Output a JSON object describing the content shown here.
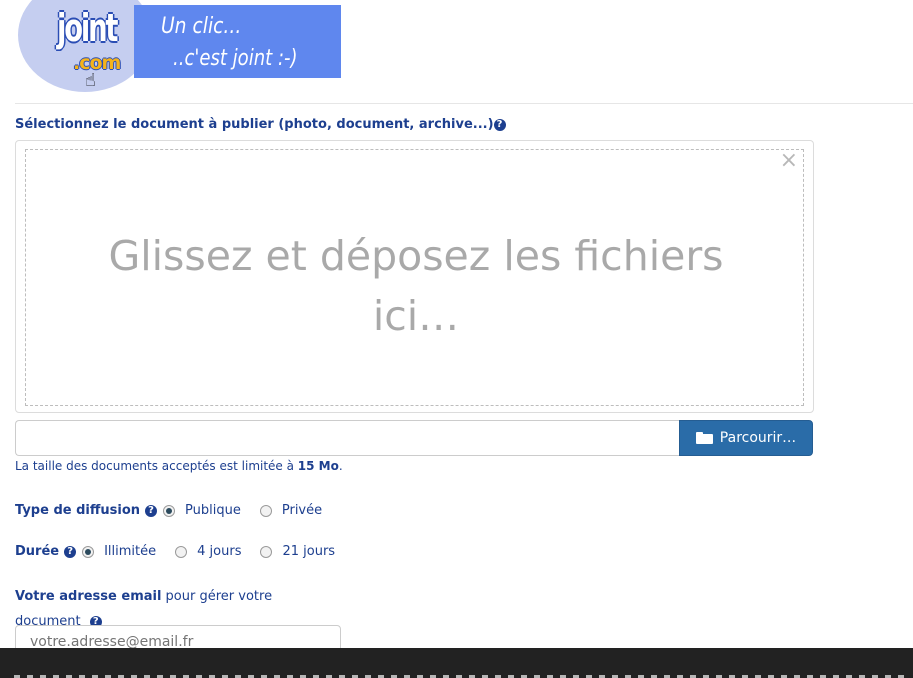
{
  "logo": {
    "joint": "joint",
    "com": ".com",
    "tagline_1": "Un clic...",
    "tagline_2": "..c'est joint :-)"
  },
  "upload": {
    "label": "Sélectionnez le document à publier (photo, document, archive...)",
    "dropzone_text": "Glissez et déposez les fichiers ici…",
    "close_symbol": "×",
    "browse_label": "Parcourir…",
    "size_note_prefix": "La taille des documents acceptés est limitée à ",
    "size_limit": "15 Mo",
    "size_note_suffix": "."
  },
  "diffusion": {
    "label": "Type de diffusion",
    "options": [
      {
        "label": "Publique",
        "checked": true
      },
      {
        "label": "Privée",
        "checked": false
      }
    ]
  },
  "duree": {
    "label": "Durée",
    "options": [
      {
        "label": "Illimitée",
        "checked": true
      },
      {
        "label": "4 jours",
        "checked": false
      },
      {
        "label": "21 jours",
        "checked": false
      }
    ]
  },
  "email": {
    "label_bold": "Votre adresse email",
    "label_rest": " pour gérer votre document",
    "placeholder": "votre.adresse@email.fr"
  },
  "icons": {
    "help": "question-circle-icon",
    "folder": "folder-open-icon"
  },
  "colors": {
    "text": "#1d3f8f",
    "button": "#2a6ca8",
    "cookie_bar": "#222222"
  }
}
